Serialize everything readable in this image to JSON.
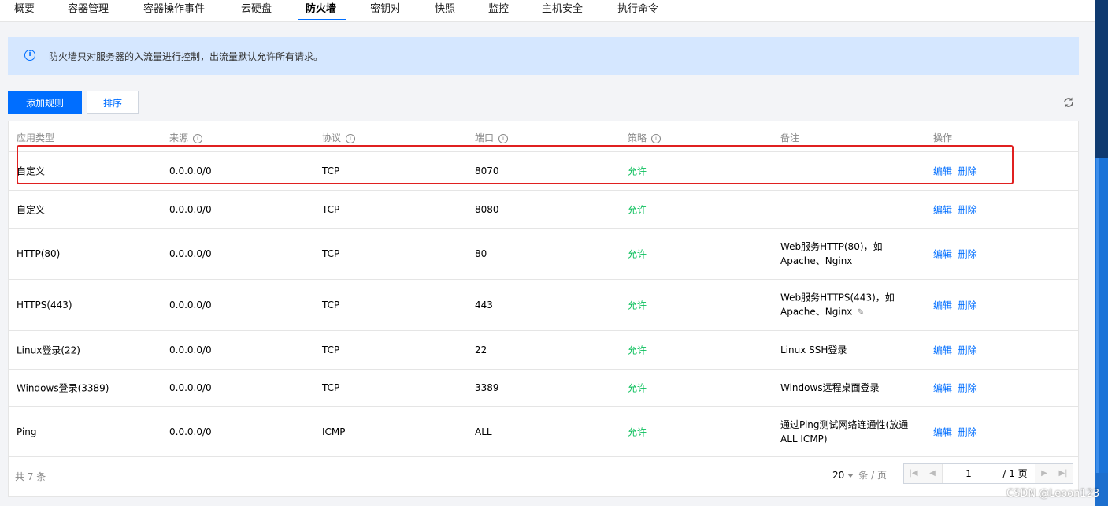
{
  "tabs": [
    {
      "label": "概要"
    },
    {
      "label": "容器管理"
    },
    {
      "label": "容器操作事件"
    },
    {
      "label": "云硬盘"
    },
    {
      "label": "防火墙",
      "active": true
    },
    {
      "label": "密钥对"
    },
    {
      "label": "快照"
    },
    {
      "label": "监控"
    },
    {
      "label": "主机安全"
    },
    {
      "label": "执行命令"
    }
  ],
  "notice": {
    "icon": "info-icon",
    "text": "防火墙只对服务器的入流量进行控制，出流量默认允许所有请求。"
  },
  "toolbar": {
    "add_label": "添加规则",
    "sort_label": "排序",
    "refresh_icon": "refresh-icon"
  },
  "table": {
    "headers": {
      "app_type": "应用类型",
      "source": "来源",
      "protocol": "协议",
      "port": "端口",
      "policy": "策略",
      "note": "备注",
      "action": "操作"
    },
    "rows": [
      {
        "app_type": "自定义",
        "source": "0.0.0.0/0",
        "protocol": "TCP",
        "port": "8070",
        "policy": "允许",
        "note_line1": "",
        "note_line2": "",
        "edit": "编辑",
        "delete": "删除"
      },
      {
        "app_type": "自定义",
        "source": "0.0.0.0/0",
        "protocol": "TCP",
        "port": "8080",
        "policy": "允许",
        "note_line1": "",
        "note_line2": "",
        "edit": "编辑",
        "delete": "删除"
      },
      {
        "app_type": "HTTP(80)",
        "source": "0.0.0.0/0",
        "protocol": "TCP",
        "port": "80",
        "policy": "允许",
        "note_line1": "Web服务HTTP(80)，如",
        "note_line2": "Apache、Nginx",
        "edit": "编辑",
        "delete": "删除"
      },
      {
        "app_type": "HTTPS(443)",
        "source": "0.0.0.0/0",
        "protocol": "TCP",
        "port": "443",
        "policy": "允许",
        "note_line1": "Web服务HTTPS(443)，如",
        "note_line2": "Apache、Nginx",
        "edit": "编辑",
        "delete": "删除"
      },
      {
        "app_type": "Linux登录(22)",
        "source": "0.0.0.0/0",
        "protocol": "TCP",
        "port": "22",
        "policy": "允许",
        "note_line1": "Linux SSH登录",
        "note_line2": "",
        "edit": "编辑",
        "delete": "删除"
      },
      {
        "app_type": "Windows登录(3389)",
        "source": "0.0.0.0/0",
        "protocol": "TCP",
        "port": "3389",
        "policy": "允许",
        "note_line1": "Windows远程桌面登录",
        "note_line2": "",
        "edit": "编辑",
        "delete": "删除"
      },
      {
        "app_type": "Ping",
        "source": "0.0.0.0/0",
        "protocol": "ICMP",
        "port": "ALL",
        "policy": "允许",
        "note_line1": "通过Ping测试网络连通性(放通",
        "note_line2": "ALL ICMP)",
        "edit": "编辑",
        "delete": "删除"
      }
    ]
  },
  "footer": {
    "total": "共 7 条",
    "page_size": "20",
    "page_size_unit": "条 / 页",
    "current_page": "1",
    "total_pages": "/ 1 页"
  },
  "watermark": "CSDN @Leoon123",
  "colors": {
    "accent": "#006eff",
    "allow": "#0abf5b",
    "highlight": "#e02020",
    "notice_bg": "#d5e7ff"
  }
}
